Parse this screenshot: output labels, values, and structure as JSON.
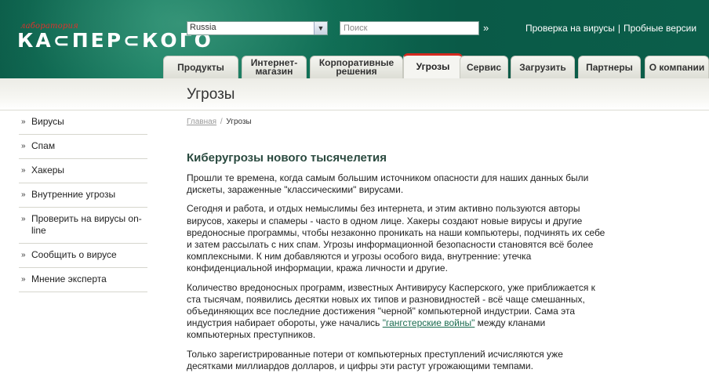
{
  "header": {
    "logo_small": "лаборатория",
    "logo_big": "КА⊂ПЕР⊂КОГО",
    "region_value": "Russia",
    "search_placeholder": "Поиск",
    "links": [
      "Проверка на вирусы",
      "Пробные версии"
    ],
    "link_separator": "|"
  },
  "tabs": [
    {
      "label": "Продукты"
    },
    {
      "label": "Интернет-\nмагазин"
    },
    {
      "label": "Корпоративные\nрешения"
    },
    {
      "label": "Угрозы",
      "active": true
    },
    {
      "label": "Сервис"
    },
    {
      "label": "Загрузить"
    },
    {
      "label": "Партнеры"
    },
    {
      "label": "О компании"
    }
  ],
  "page": {
    "title": "Угрозы"
  },
  "sidebar": {
    "items": [
      {
        "label": "Вирусы"
      },
      {
        "label": "Спам"
      },
      {
        "label": "Хакеры"
      },
      {
        "label": "Внутренние угрозы"
      },
      {
        "label": "Проверить на вирусы on-line"
      },
      {
        "label": "Сообщить о вирусе"
      },
      {
        "label": "Мнение эксперта"
      }
    ]
  },
  "breadcrumb": {
    "home": "Главная",
    "separator": "/",
    "current": "Угрозы"
  },
  "content": {
    "title": "Киберугрозы нового тысячелетия",
    "p1": "Прошли те времена, когда самым большим источником опасности для наших данных были дискеты, зараженные \"классическими\" вирусами.",
    "p2": "Сегодня и работа, и отдых немыслимы без интернета, и этим активно пользуются авторы вирусов, хакеры и спамеры - часто в одном лице. Хакеры создают новые вирусы и другие вредоносные программы, чтобы незаконно проникать на наши компьютеры, подчинять их себе и затем рассылать с них спам. Угрозы информационной безопасности становятся всё более комплексными. К ним добавляются и угрозы особого вида, внутренние: утечка конфиденциальной информации, кража личности и другие.",
    "p3_before": "Количество вредоносных программ, известных Антивирусу Касперского, уже приближается к ста тысячам, появились десятки новых их типов и разновидностей - всё чаще смешанных, объединяющих все последние достижения \"черной\" компьютерной индустрии. Сама эта индустрия набирает обороты, уже начались ",
    "p3_link": "\"гангстерские войны\"",
    "p3_after": " между кланами компьютерных преступников.",
    "p4": "Только зарегистрированные потери от компьютерных преступлений исчисляются уже десятками миллиардов долларов, и цифры эти растут угрожающими темпами."
  }
}
